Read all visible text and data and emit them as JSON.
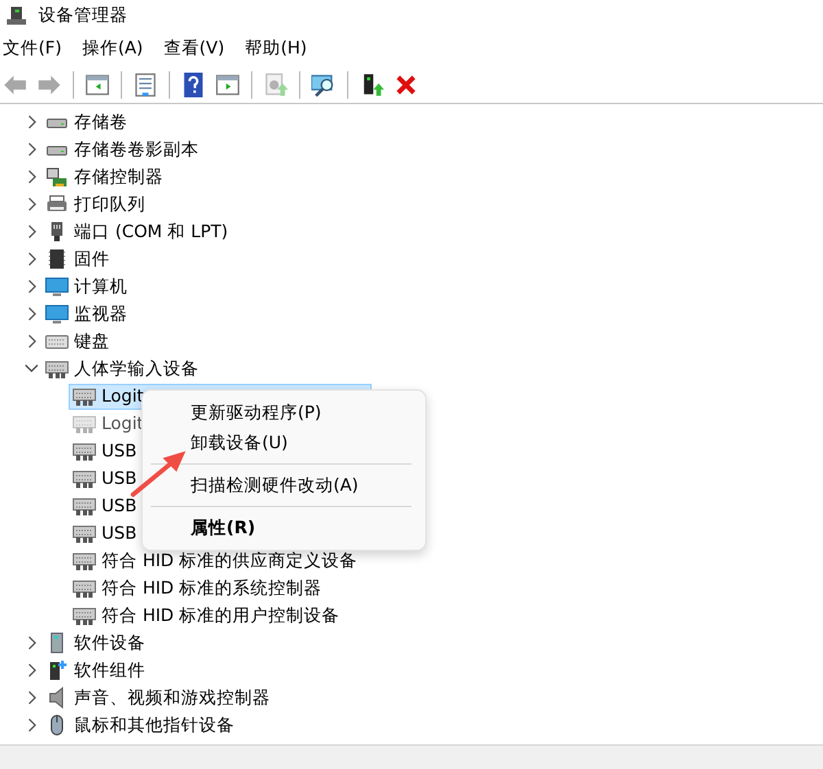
{
  "window": {
    "title": "设备管理器"
  },
  "menu": [
    "文件(F)",
    "操作(A)",
    "查看(V)",
    "帮助(H)"
  ],
  "toolbar": [
    {
      "kind": "back",
      "disabled": true
    },
    {
      "kind": "forward",
      "disabled": true
    },
    {
      "kind": "sep"
    },
    {
      "kind": "console-tree",
      "disabled": false
    },
    {
      "kind": "sep"
    },
    {
      "kind": "properties",
      "disabled": false
    },
    {
      "kind": "sep"
    },
    {
      "kind": "help",
      "disabled": false
    },
    {
      "kind": "action-pane",
      "disabled": false
    },
    {
      "kind": "sep"
    },
    {
      "kind": "update-driver",
      "disabled": true
    },
    {
      "kind": "sep"
    },
    {
      "kind": "scan",
      "disabled": false
    },
    {
      "kind": "sep"
    },
    {
      "kind": "enable",
      "disabled": false
    },
    {
      "kind": "uninstall",
      "disabled": false
    }
  ],
  "tree": [
    {
      "label": "存储卷",
      "kind": "drive",
      "expanded": false
    },
    {
      "label": "存储卷卷影副本",
      "kind": "drive",
      "expanded": false
    },
    {
      "label": "存储控制器",
      "kind": "controller",
      "expanded": false
    },
    {
      "label": "打印队列",
      "kind": "printer",
      "expanded": false
    },
    {
      "label": "端口 (COM 和 LPT)",
      "kind": "port",
      "expanded": false
    },
    {
      "label": "固件",
      "kind": "chip",
      "expanded": false
    },
    {
      "label": "计算机",
      "kind": "monitor",
      "expanded": false
    },
    {
      "label": "监视器",
      "kind": "monitor",
      "expanded": false
    },
    {
      "label": "键盘",
      "kind": "keyboard",
      "expanded": false
    },
    {
      "label": "人体学输入设备",
      "kind": "hid",
      "expanded": true,
      "children": [
        {
          "label": "Logit",
          "selected": true,
          "disabled": false
        },
        {
          "label": "Logit",
          "selected": false,
          "disabled": true
        },
        {
          "label": "USB",
          "selected": false,
          "disabled": false
        },
        {
          "label": "USB",
          "selected": false,
          "disabled": false
        },
        {
          "label": "USB",
          "selected": false,
          "disabled": false
        },
        {
          "label": "USB",
          "selected": false,
          "disabled": false
        },
        {
          "label": "符合 HID 标准的供应商定义设备",
          "selected": false,
          "disabled": false
        },
        {
          "label": "符合 HID 标准的系统控制器",
          "selected": false,
          "disabled": false
        },
        {
          "label": "符合 HID 标准的用户控制设备",
          "selected": false,
          "disabled": false
        }
      ]
    },
    {
      "label": "软件设备",
      "kind": "tower",
      "expanded": false
    },
    {
      "label": "软件组件",
      "kind": "component",
      "expanded": false
    },
    {
      "label": "声音、视频和游戏控制器",
      "kind": "speaker",
      "expanded": false
    },
    {
      "label": "鼠标和其他指针设备",
      "kind": "mouse",
      "expanded": false
    }
  ],
  "context_menu": [
    {
      "kind": "item",
      "label": "更新驱动程序(P)",
      "default": false
    },
    {
      "kind": "item",
      "label": "卸载设备(U)",
      "default": false
    },
    {
      "kind": "separator"
    },
    {
      "kind": "item",
      "label": "扫描检测硬件改动(A)",
      "default": false
    },
    {
      "kind": "separator"
    },
    {
      "kind": "item",
      "label": "属性(R)",
      "default": true
    }
  ]
}
